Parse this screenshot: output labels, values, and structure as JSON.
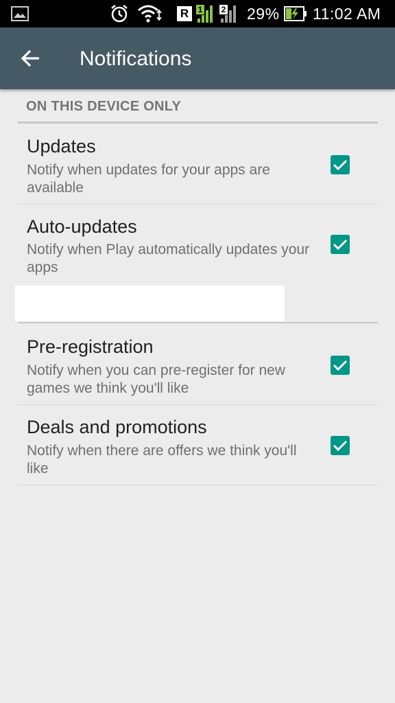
{
  "status_bar": {
    "signal1_label": "1",
    "signal2_label": "2",
    "roaming_label": "R",
    "battery_percent": "29%",
    "time": "11:02 AM",
    "icons": [
      "image-icon",
      "alarm-icon",
      "wifi-icon",
      "roaming-icon",
      "signal-icon",
      "battery-charging-icon"
    ]
  },
  "appbar": {
    "title": "Notifications",
    "back_icon": "arrow-back-icon",
    "color": "#455a64"
  },
  "section": {
    "header": "ON THIS DEVICE ONLY"
  },
  "settings": [
    {
      "title": "Updates",
      "subtitle": "Notify when updates for your apps are available",
      "checked": true
    },
    {
      "title": "Auto-updates",
      "subtitle": "Notify when Play automatically updates your apps",
      "checked": true
    },
    {
      "title": "Pre-registration",
      "subtitle": "Notify when you can pre-register for new games we think you'll like",
      "checked": true
    },
    {
      "title": "Deals and promotions",
      "subtitle": "Notify when there are offers we think you'll like",
      "checked": true
    }
  ],
  "colors": {
    "accent": "#009688",
    "background": "#ececec"
  }
}
